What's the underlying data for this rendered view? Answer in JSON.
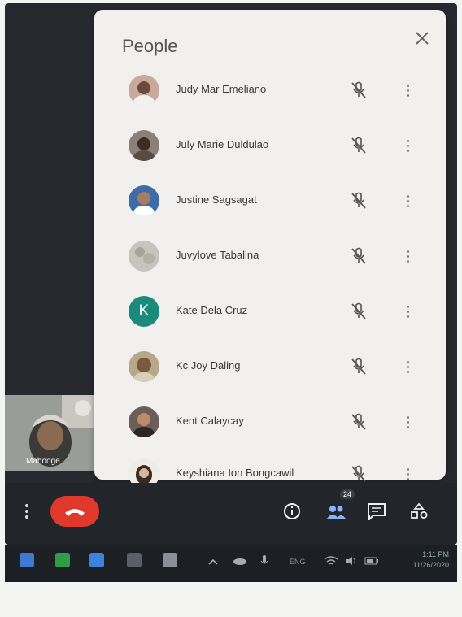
{
  "panel": {
    "title": "People",
    "participants": [
      {
        "name": "Judy Mar Emeliano",
        "avatar": "photo"
      },
      {
        "name": "July Marie Duldulao",
        "avatar": "photo"
      },
      {
        "name": "Justine Sagsagat",
        "avatar": "photo"
      },
      {
        "name": "Juvylove Tabalina",
        "avatar": "photo"
      },
      {
        "name": "Kate Dela Cruz",
        "avatar": "letter",
        "letter": "K",
        "color": "#1a8a7a"
      },
      {
        "name": "Kc Joy Daling",
        "avatar": "photo"
      },
      {
        "name": "Kent Calaycay",
        "avatar": "photo"
      },
      {
        "name": "Keyshiana Ion Bongcawil",
        "avatar": "photo"
      }
    ]
  },
  "self_tile": {
    "label": "Mabooge"
  },
  "controls": {
    "people_badge": "24",
    "icons": [
      "more-vert-icon",
      "end-call-icon",
      "info-icon",
      "people-icon",
      "chat-icon",
      "activities-icon"
    ]
  },
  "taskbar": {
    "tray_text": "ENG",
    "time": "1:11 PM",
    "date": "11/26/2020"
  },
  "colors": {
    "end_call": "#e1382c",
    "accent": "#1a73e8",
    "letter_avatar": "#1a8a7a"
  }
}
